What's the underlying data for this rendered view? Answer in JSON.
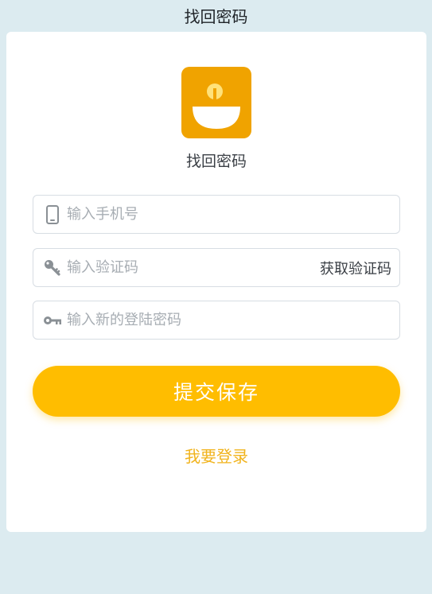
{
  "header": {
    "title": "找回密码"
  },
  "card": {
    "subtitle": "找回密码"
  },
  "form": {
    "phone": {
      "placeholder": "输入手机号",
      "value": ""
    },
    "code": {
      "placeholder": "输入验证码",
      "value": "",
      "get_code_label": "获取验证码"
    },
    "password": {
      "placeholder": "输入新的登陆密码",
      "value": ""
    }
  },
  "actions": {
    "submit_label": "提交保存",
    "login_link_label": "我要登录"
  },
  "colors": {
    "page_bg": "#dcebf0",
    "accent": "#ffbd00",
    "logo_bg": "#f0a300",
    "link": "#f1b31c",
    "icon": "#8a9095"
  },
  "icons": {
    "phone": "mobile-phone-icon",
    "code": "key-icon",
    "password": "key-horizontal-icon",
    "logo": "app-logo-icon"
  }
}
